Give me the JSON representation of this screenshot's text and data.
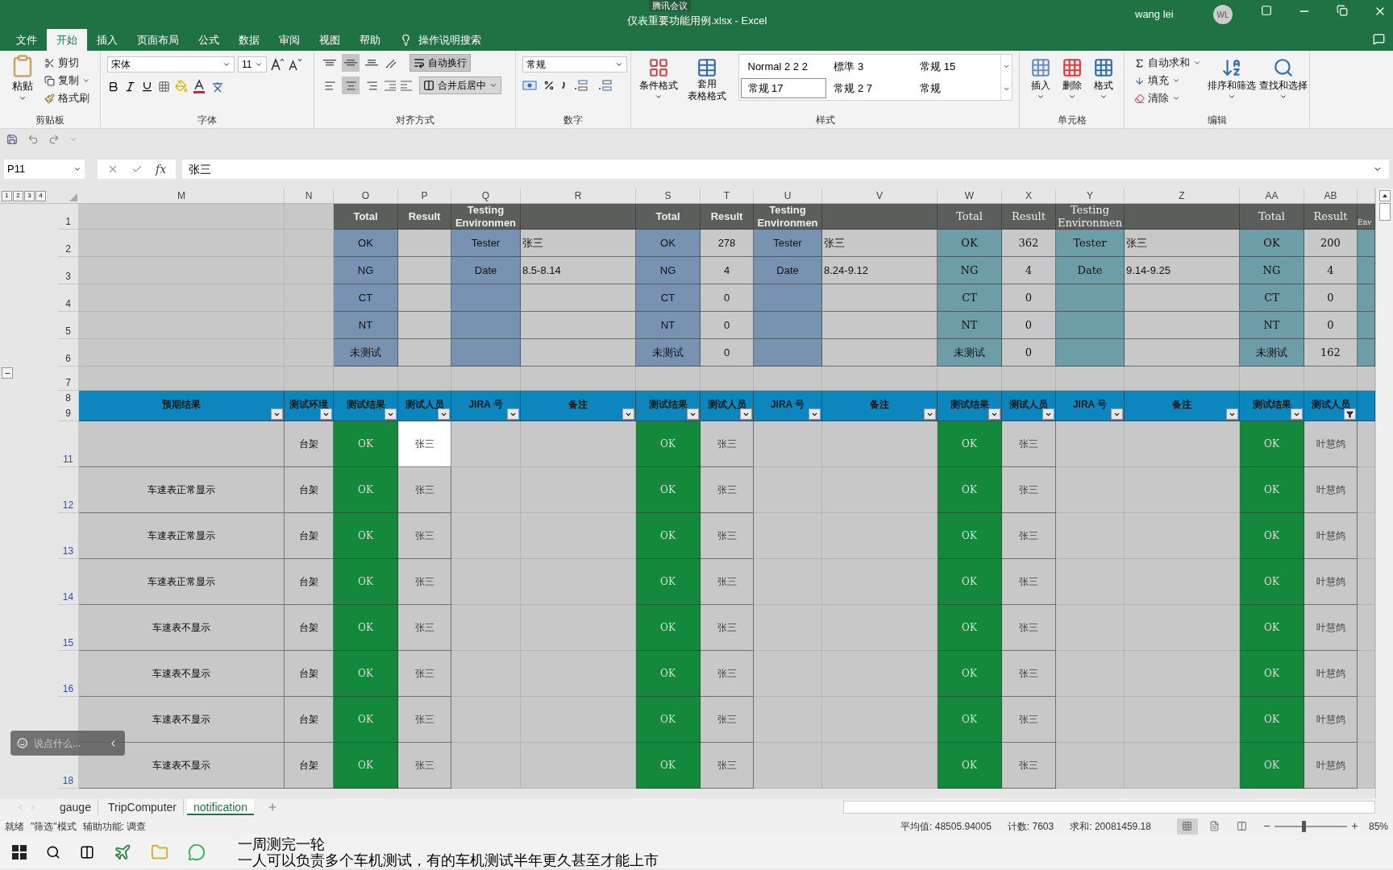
{
  "title_bar": {
    "file_title": "仪表重要功能用例.xlsx  -  Excel",
    "meeting_badge": "腾讯会议",
    "user_name": "wang lei",
    "avatar_initials": "WL"
  },
  "ribbon_tabs": [
    {
      "label": "文件",
      "selected": false
    },
    {
      "label": "开始",
      "selected": true
    },
    {
      "label": "插入",
      "selected": false
    },
    {
      "label": "页面布局",
      "selected": false
    },
    {
      "label": "公式",
      "selected": false
    },
    {
      "label": "数据",
      "selected": false
    },
    {
      "label": "审阅",
      "selected": false
    },
    {
      "label": "视图",
      "selected": false
    },
    {
      "label": "帮助",
      "selected": false
    }
  ],
  "tell_me": "操作说明搜索",
  "ribbon": {
    "clipboard": {
      "title": "剪贴板",
      "paste": "粘贴",
      "cut": "剪切",
      "copy": "复制",
      "format_painter": "格式刷"
    },
    "font": {
      "title": "字体",
      "font_name": "宋体",
      "font_size": "11"
    },
    "alignment": {
      "title": "对齐方式",
      "wrap_text": {
        "label": "自动换行",
        "on": true
      },
      "merge_center": "合并后居中",
      "vertical": [
        {
          "kind": "top",
          "on": false
        },
        {
          "kind": "middle",
          "on": true
        },
        {
          "kind": "bottom",
          "on": false
        }
      ],
      "horizontal": [
        {
          "kind": "left",
          "on": false
        },
        {
          "kind": "center",
          "on": true
        },
        {
          "kind": "right",
          "on": false
        }
      ]
    },
    "number": {
      "title": "数字",
      "format": "常规"
    },
    "styles": {
      "title": "样式",
      "conditional_formatting": "条件格式",
      "format_as_table": [
        "套用",
        "表格格式"
      ],
      "gallery": [
        {
          "label": "Normal 2 2 2",
          "selected": false
        },
        {
          "label": "標準 3",
          "selected": false
        },
        {
          "label": "常规 15",
          "selected": false
        },
        {
          "label": "常规 17",
          "selected": true
        },
        {
          "label": "常规 2 7",
          "selected": false
        },
        {
          "label": "常规",
          "selected": false
        }
      ]
    },
    "cells": {
      "title": "单元格",
      "insert": "插入",
      "delete": "删除",
      "format": "格式"
    },
    "editing": {
      "title": "编辑",
      "autosum": "自动求和",
      "fill": "填充",
      "clear": "清除",
      "sort_filter": "排序和筛选",
      "find_select": "查找和选择"
    }
  },
  "formula_bar": {
    "name_box": "P11",
    "fx": "fx",
    "value": "张三"
  },
  "outline_levels": [
    "1",
    "2",
    "3",
    "4"
  ],
  "columns": [
    "M",
    "N",
    "O",
    "P",
    "Q",
    "R",
    "S",
    "T",
    "U",
    "V",
    "W",
    "X",
    "Y",
    "Z",
    "AA",
    "AB"
  ],
  "summary_rows": [
    "1",
    "2",
    "3",
    "4",
    "5",
    "6"
  ],
  "summary_blocks": [
    {
      "kind": "sans",
      "header": {
        "total": "Total",
        "result": "Result",
        "env": "Testing Environmen"
      },
      "rows": [
        {
          "total_label": "OK",
          "env_label": "Tester",
          "env_value": "张三"
        },
        {
          "total_label": "NG",
          "env_label": "Date",
          "env_value": "8.5-8.14"
        },
        {
          "total_label": "CT"
        },
        {
          "total_label": "NT"
        },
        {
          "total_label": "未测试"
        }
      ]
    },
    {
      "kind": "sans",
      "header": {
        "total": "Total",
        "result": "Result",
        "env": "Testing Environmen"
      },
      "rows": [
        {
          "total_label": "OK",
          "result": "278",
          "env_label": "Tester",
          "env_value": "张三"
        },
        {
          "total_label": "NG",
          "result": "4",
          "env_label": "Date",
          "env_value": "8.24-9.12"
        },
        {
          "total_label": "CT",
          "result": "0"
        },
        {
          "total_label": "NT",
          "result": "0"
        },
        {
          "total_label": "未测试",
          "result": "0"
        }
      ]
    },
    {
      "kind": "serif",
      "header": {
        "total": "Total",
        "result": "Result",
        "env": "Testing Environmen"
      },
      "rows": [
        {
          "total_label": "OK",
          "result": "362",
          "env_label": "Tester",
          "env_value": "张三"
        },
        {
          "total_label": "NG",
          "result": "4",
          "env_label": "Date",
          "env_value": "9.14-9.25"
        },
        {
          "total_label": "CT",
          "result": "0"
        },
        {
          "total_label": "NT",
          "result": "0"
        },
        {
          "total_label": "未测试",
          "result": "0"
        }
      ]
    },
    {
      "kind": "serif",
      "header": {
        "total": "Total",
        "result": "Result",
        "env": "Env"
      },
      "rows": [
        {
          "total_label": "OK",
          "result": "200"
        },
        {
          "total_label": "NG",
          "result": "4"
        },
        {
          "total_label": "CT",
          "result": "0"
        },
        {
          "total_label": "NT",
          "result": "0"
        },
        {
          "total_label": "未测试",
          "result": "162"
        }
      ]
    }
  ],
  "gap_row": "7",
  "header_rows": [
    "8",
    "9"
  ],
  "table_headers": [
    {
      "label": "预期结果",
      "filtered": false
    },
    {
      "label": "测试环境",
      "filtered": false
    },
    {
      "label": "测试结果",
      "filtered": false
    },
    {
      "label": "测试人员",
      "filtered": false
    },
    {
      "label": "JIRA 号",
      "filtered": false
    },
    {
      "label": "备注",
      "filtered": false
    },
    {
      "label": "测试结果",
      "filtered": false
    },
    {
      "label": "测试人员",
      "filtered": false
    },
    {
      "label": "JIRA 号",
      "filtered": false
    },
    {
      "label": "备注",
      "filtered": false
    },
    {
      "label": "测试结果",
      "filtered": false
    },
    {
      "label": "测试人员",
      "filtered": false
    },
    {
      "label": "JIRA 号",
      "filtered": false
    },
    {
      "label": "备注",
      "filtered": false
    },
    {
      "label": "测试结果",
      "filtered": false
    },
    {
      "label": "测试人员",
      "filtered": true
    }
  ],
  "data_rows": [
    {
      "number": "11",
      "filtered": true,
      "environment": "台架",
      "tester_selected": true,
      "results": [
        {
          "kind": "pass",
          "result": "OK",
          "tester": "张三"
        },
        {
          "kind": "pass",
          "result": "OK",
          "tester": "张三"
        },
        {
          "kind": "pass",
          "result": "OK",
          "tester": "张三"
        },
        {
          "kind": "pass",
          "result": "OK",
          "tester": "叶慧鸽"
        }
      ]
    },
    {
      "number": "12",
      "filtered": true,
      "expected": "车速表正常显示",
      "environment": "台架",
      "tester_selected": false,
      "results": [
        {
          "kind": "pass",
          "result": "OK",
          "tester": "张三"
        },
        {
          "kind": "pass",
          "result": "OK",
          "tester": "张三"
        },
        {
          "kind": "pass",
          "result": "OK",
          "tester": "张三"
        },
        {
          "kind": "pass",
          "result": "OK",
          "tester": "叶慧鸽"
        }
      ]
    },
    {
      "number": "13",
      "filtered": true,
      "expected": "车速表正常显示",
      "environment": "台架",
      "tester_selected": false,
      "results": [
        {
          "kind": "pass",
          "result": "OK",
          "tester": "张三"
        },
        {
          "kind": "pass",
          "result": "OK",
          "tester": "张三"
        },
        {
          "kind": "pass",
          "result": "OK",
          "tester": "张三"
        },
        {
          "kind": "pass",
          "result": "OK",
          "tester": "叶慧鸽"
        }
      ]
    },
    {
      "number": "14",
      "filtered": true,
      "expected": "车速表正常显示",
      "environment": "台架",
      "tester_selected": false,
      "results": [
        {
          "kind": "pass",
          "result": "OK",
          "tester": "张三"
        },
        {
          "kind": "pass",
          "result": "OK",
          "tester": "张三"
        },
        {
          "kind": "pass",
          "result": "OK",
          "tester": "张三"
        },
        {
          "kind": "pass",
          "result": "OK",
          "tester": "叶慧鸽"
        }
      ]
    },
    {
      "number": "15",
      "filtered": true,
      "expected": "车速表不显示",
      "environment": "台架",
      "tester_selected": false,
      "results": [
        {
          "kind": "pass",
          "result": "OK",
          "tester": "张三"
        },
        {
          "kind": "pass",
          "result": "OK",
          "tester": "张三"
        },
        {
          "kind": "pass",
          "result": "OK",
          "tester": "张三"
        },
        {
          "kind": "pass",
          "result": "OK",
          "tester": "叶慧鸽"
        }
      ]
    },
    {
      "number": "16",
      "filtered": true,
      "expected": "车速表不显示",
      "environment": "台架",
      "tester_selected": false,
      "results": [
        {
          "kind": "pass",
          "result": "OK",
          "tester": "张三"
        },
        {
          "kind": "pass",
          "result": "OK",
          "tester": "张三"
        },
        {
          "kind": "pass",
          "result": "OK",
          "tester": "张三"
        },
        {
          "kind": "pass",
          "result": "OK",
          "tester": "叶慧鸽"
        }
      ]
    },
    {
      "expected": "车速表不显示",
      "environment": "台架",
      "tester_selected": false,
      "results": [
        {
          "kind": "pass",
          "result": "OK",
          "tester": "张三"
        },
        {
          "kind": "pass",
          "result": "OK",
          "tester": "张三"
        },
        {
          "kind": "pass",
          "result": "OK",
          "tester": "张三"
        },
        {
          "kind": "pass",
          "result": "OK",
          "tester": "叶慧鸽"
        }
      ]
    },
    {
      "number": "18",
      "filtered": true,
      "expected": "车速表不显示",
      "environment": "台架",
      "tester_selected": false,
      "results": [
        {
          "kind": "pass",
          "result": "OK",
          "tester": "张三"
        },
        {
          "kind": "pass",
          "result": "OK",
          "tester": "张三"
        },
        {
          "kind": "pass",
          "result": "OK",
          "tester": "张三"
        },
        {
          "kind": "pass",
          "result": "OK",
          "tester": "叶慧鸽"
        }
      ]
    }
  ],
  "chat_overlay": {
    "placeholder": "说点什么..."
  },
  "sheet_tabs": [
    {
      "label": "gauge",
      "selected": false
    },
    {
      "label": "TripComputer",
      "selected": false
    },
    {
      "label": "notification",
      "selected": true
    }
  ],
  "status_bar": {
    "ready": "就绪",
    "filter_mode": "\"筛选\"模式",
    "accessibility": "辅助功能: 调查",
    "average": "平均值: 48505.94005",
    "count": "计数: 7603",
    "sum": "求和: 20081459.18",
    "view_buttons": [
      {
        "kind": "normal",
        "selected": true
      },
      {
        "kind": "page_layout",
        "selected": false
      },
      {
        "kind": "page_break",
        "selected": false
      }
    ],
    "zoom": {
      "level": 0.4,
      "reading": "85%"
    }
  },
  "subtitles": [
    "一周测完一轮",
    "一人可以负责多个车机测试，有的车机测试半年更久甚至才能上市"
  ]
}
